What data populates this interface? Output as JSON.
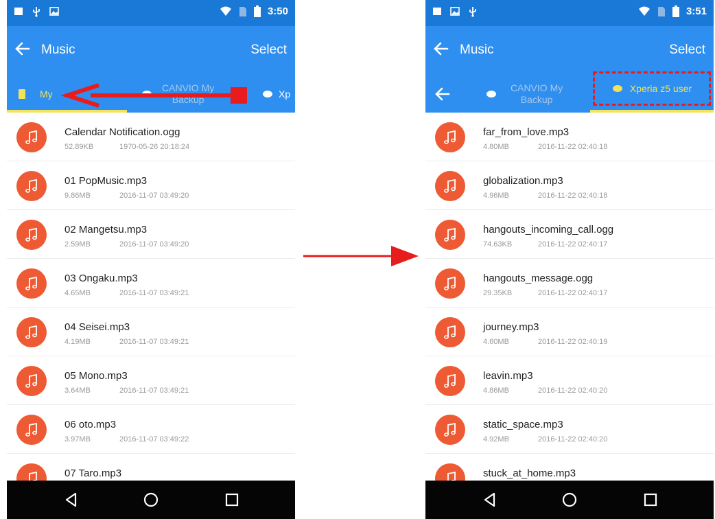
{
  "colors": {
    "statusbar": "#1a78d6",
    "appbar": "#2e8ff0",
    "accent_yellow": "#f2e35a",
    "note_icon": "#ee5a33",
    "annotation_red": "#e81c1c",
    "navbar": "#050505"
  },
  "left": {
    "status_time": "3:50",
    "app_title": "Music",
    "select_label": "Select",
    "tabs": [
      "My Phone",
      "CANVIO My Backup",
      "Xp"
    ],
    "tab_my_phone_visible": "My ",
    "tab_canvio_line1": "CANVIO My",
    "tab_canvio_line2": "Backup",
    "tab_xp": "Xp",
    "files": [
      {
        "name": "Calendar Notification.ogg",
        "size": "52.89KB",
        "date": "1970-05-26 20:18:24"
      },
      {
        "name": "01 PopMusic.mp3",
        "size": "9.86MB",
        "date": "2016-11-07 03:49:20"
      },
      {
        "name": "02 Mangetsu.mp3",
        "size": "2.59MB",
        "date": "2016-11-07 03:49:20"
      },
      {
        "name": "03 Ongaku.mp3",
        "size": "4.65MB",
        "date": "2016-11-07 03:49:21"
      },
      {
        "name": "04 Seisei.mp3",
        "size": "4.19MB",
        "date": "2016-11-07 03:49:21"
      },
      {
        "name": "05 Mono.mp3",
        "size": "3.64MB",
        "date": "2016-11-07 03:49:21"
      },
      {
        "name": "06 oto.mp3",
        "size": "3.97MB",
        "date": "2016-11-07 03:49:22"
      },
      {
        "name": "07 Taro.mp3",
        "size": "",
        "date": ""
      }
    ]
  },
  "right": {
    "status_time": "3:51",
    "app_title": "Music",
    "select_label": "Select",
    "tab_canvio_line1": "CANVIO My",
    "tab_canvio_line2": "Backup",
    "tab_xperia": "Xperia z5 user",
    "files": [
      {
        "name": "far_from_love.mp3",
        "size": "4.80MB",
        "date": "2016-11-22 02:40:18"
      },
      {
        "name": "globalization.mp3",
        "size": "4.96MB",
        "date": "2016-11-22 02:40:18"
      },
      {
        "name": "hangouts_incoming_call.ogg",
        "size": "74.63KB",
        "date": "2016-11-22 02:40:17"
      },
      {
        "name": "hangouts_message.ogg",
        "size": "29.35KB",
        "date": "2016-11-22 02:40:17"
      },
      {
        "name": "journey.mp3",
        "size": "4.60MB",
        "date": "2016-11-22 02:40:19"
      },
      {
        "name": "leavin.mp3",
        "size": "4.86MB",
        "date": "2016-11-22 02:40:20"
      },
      {
        "name": "static_space.mp3",
        "size": "4.92MB",
        "date": "2016-11-22 02:40:20"
      },
      {
        "name": "stuck_at_home.mp3",
        "size": "",
        "date": ""
      }
    ]
  },
  "icons": {
    "back": "arrow-left-icon",
    "note": "music-note-icon",
    "nav": [
      "back-triangle-icon",
      "home-circle-icon",
      "recents-square-icon"
    ]
  }
}
